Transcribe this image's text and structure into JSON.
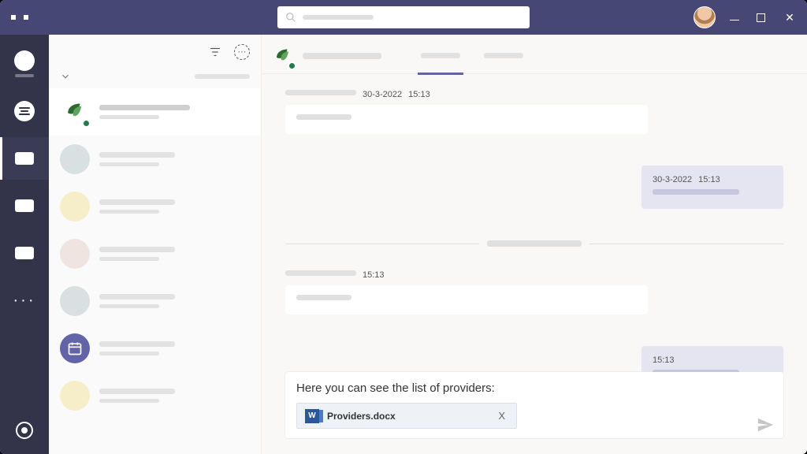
{
  "titlebar": {
    "search_placeholder": "Search"
  },
  "rail": {
    "items": [
      "activity",
      "chat",
      "teams",
      "calendar",
      "calls"
    ]
  },
  "chatlist": {
    "items": [
      {
        "avatar": "leaf",
        "active": true
      },
      {
        "avatar": "blue"
      },
      {
        "avatar": "yellow"
      },
      {
        "avatar": "pink"
      },
      {
        "avatar": "blue"
      },
      {
        "avatar": "cal"
      },
      {
        "avatar": "yellow"
      }
    ]
  },
  "conversation": {
    "messages": [
      {
        "side": "left",
        "date": "30-3-2022",
        "time": "15:13"
      },
      {
        "side": "right",
        "date": "30-3-2022",
        "time": "15:13"
      },
      {
        "divider": true
      },
      {
        "side": "left",
        "date": "",
        "time": "15:13"
      },
      {
        "side": "right",
        "date": "",
        "time": "15:13"
      }
    ]
  },
  "compose": {
    "text": "Here you can see the list of providers:",
    "attachment": {
      "name": "Providers.docx",
      "close_label": "X",
      "type": "word"
    }
  }
}
